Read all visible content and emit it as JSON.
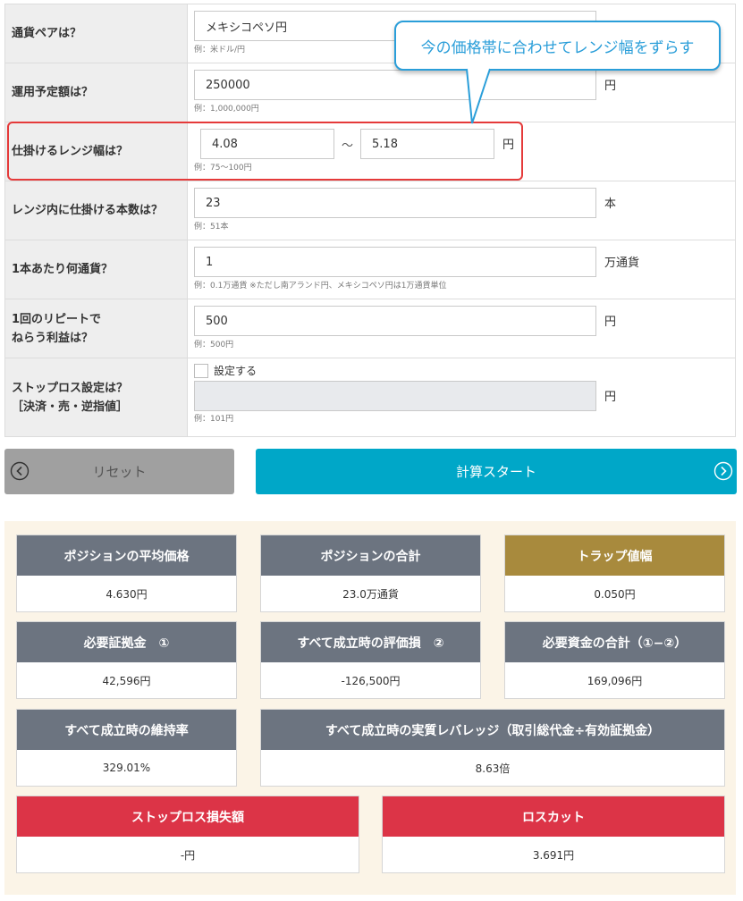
{
  "form": {
    "currency_pair": {
      "label": "通貨ペアは？",
      "value": "メキシコペソ円",
      "example": "例：米ドル/円"
    },
    "operating_amount": {
      "label": "運用予定額は？",
      "value": "250000",
      "unit": "円",
      "example": "例：1,000,000円"
    },
    "range_width": {
      "label": "仕掛けるレンジ幅は？",
      "from": "4.08",
      "separator": "〜",
      "to": "5.18",
      "unit": "円",
      "example": "例：75〜100円"
    },
    "trap_count": {
      "label": "レンジ内に仕掛ける本数は？",
      "value": "23",
      "unit": "本",
      "example": "例：51本"
    },
    "currency_per_trap": {
      "label": "1本あたり何通貨？",
      "value": "1",
      "unit": "万通貨",
      "example": "例：0.1万通貨 ※ただし南アランド円、メキシコペソ円は1万通貨単位"
    },
    "repeat_profit": {
      "label_line1": "1回のリピートで",
      "label_line2": "ねらう利益は？",
      "value": "500",
      "unit": "円",
      "example": "例：500円"
    },
    "stop_loss": {
      "label_line1": "ストップロス設定は？",
      "label_line2": "［決済・売・逆指値］",
      "checkbox_label": "設定する",
      "value": "",
      "unit": "円",
      "example": "例：101円"
    }
  },
  "callout": {
    "text": "今の価格帯に合わせてレンジ幅をずらす"
  },
  "buttons": {
    "reset": "リセット",
    "start": "計算スタート"
  },
  "results": {
    "avg_price": {
      "title": "ポジションの平均価格",
      "value": "4.630円"
    },
    "position_total": {
      "title": "ポジションの合計",
      "value": "23.0万通貨"
    },
    "trap_width": {
      "title": "トラップ値幅",
      "value": "0.050円"
    },
    "margin_required": {
      "title": "必要証拠金　①",
      "value": "42,596円"
    },
    "unrealized_loss": {
      "title": "すべて成立時の評価損　②",
      "value": "-126,500円"
    },
    "required_funds": {
      "title": "必要資金の合計（①−②）",
      "value": "169,096円"
    },
    "maintenance_rate": {
      "title": "すべて成立時の維持率",
      "value": "329.01%"
    },
    "effective_leverage": {
      "title": "すべて成立時の実質レバレッジ（取引総代金÷有効証拠金）",
      "value": "8.63倍"
    },
    "stop_loss_amount": {
      "title": "ストップロス損失額",
      "value": "-円"
    },
    "loss_cut": {
      "title": "ロスカット",
      "value": "3.691円"
    }
  },
  "colors": {
    "accent": "#00a7c8",
    "header_gray": "#6c7480",
    "header_gold": "#a88a3d",
    "header_red": "#dc3447",
    "callout_blue": "#2a9ed9",
    "highlight_red": "#e53a3a"
  }
}
